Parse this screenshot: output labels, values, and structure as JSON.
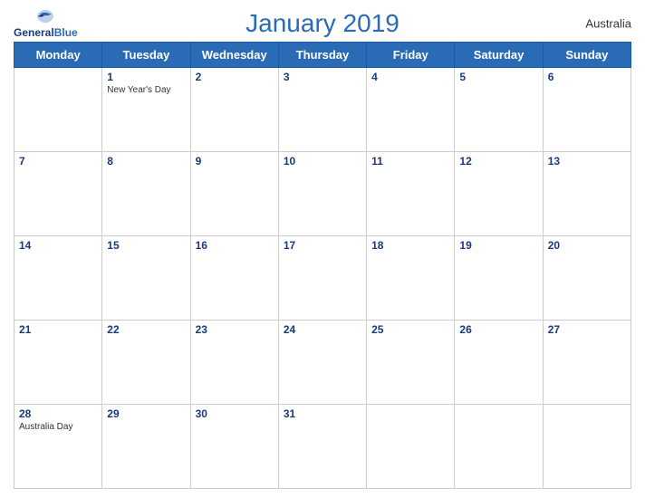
{
  "header": {
    "logo_general": "General",
    "logo_blue": "Blue",
    "title": "January 2019",
    "country": "Australia"
  },
  "days_of_week": [
    "Monday",
    "Tuesday",
    "Wednesday",
    "Thursday",
    "Friday",
    "Saturday",
    "Sunday"
  ],
  "weeks": [
    [
      {
        "day": "",
        "empty": true
      },
      {
        "day": "1",
        "holiday": "New Year's Day"
      },
      {
        "day": "2",
        "holiday": ""
      },
      {
        "day": "3",
        "holiday": ""
      },
      {
        "day": "4",
        "holiday": ""
      },
      {
        "day": "5",
        "holiday": ""
      },
      {
        "day": "6",
        "holiday": ""
      }
    ],
    [
      {
        "day": "7",
        "holiday": ""
      },
      {
        "day": "8",
        "holiday": ""
      },
      {
        "day": "9",
        "holiday": ""
      },
      {
        "day": "10",
        "holiday": ""
      },
      {
        "day": "11",
        "holiday": ""
      },
      {
        "day": "12",
        "holiday": ""
      },
      {
        "day": "13",
        "holiday": ""
      }
    ],
    [
      {
        "day": "14",
        "holiday": ""
      },
      {
        "day": "15",
        "holiday": ""
      },
      {
        "day": "16",
        "holiday": ""
      },
      {
        "day": "17",
        "holiday": ""
      },
      {
        "day": "18",
        "holiday": ""
      },
      {
        "day": "19",
        "holiday": ""
      },
      {
        "day": "20",
        "holiday": ""
      }
    ],
    [
      {
        "day": "21",
        "holiday": ""
      },
      {
        "day": "22",
        "holiday": ""
      },
      {
        "day": "23",
        "holiday": ""
      },
      {
        "day": "24",
        "holiday": ""
      },
      {
        "day": "25",
        "holiday": ""
      },
      {
        "day": "26",
        "holiday": ""
      },
      {
        "day": "27",
        "holiday": ""
      }
    ],
    [
      {
        "day": "28",
        "holiday": "Australia Day"
      },
      {
        "day": "29",
        "holiday": ""
      },
      {
        "day": "30",
        "holiday": ""
      },
      {
        "day": "31",
        "holiday": ""
      },
      {
        "day": "",
        "empty": true
      },
      {
        "day": "",
        "empty": true
      },
      {
        "day": "",
        "empty": true
      }
    ]
  ]
}
